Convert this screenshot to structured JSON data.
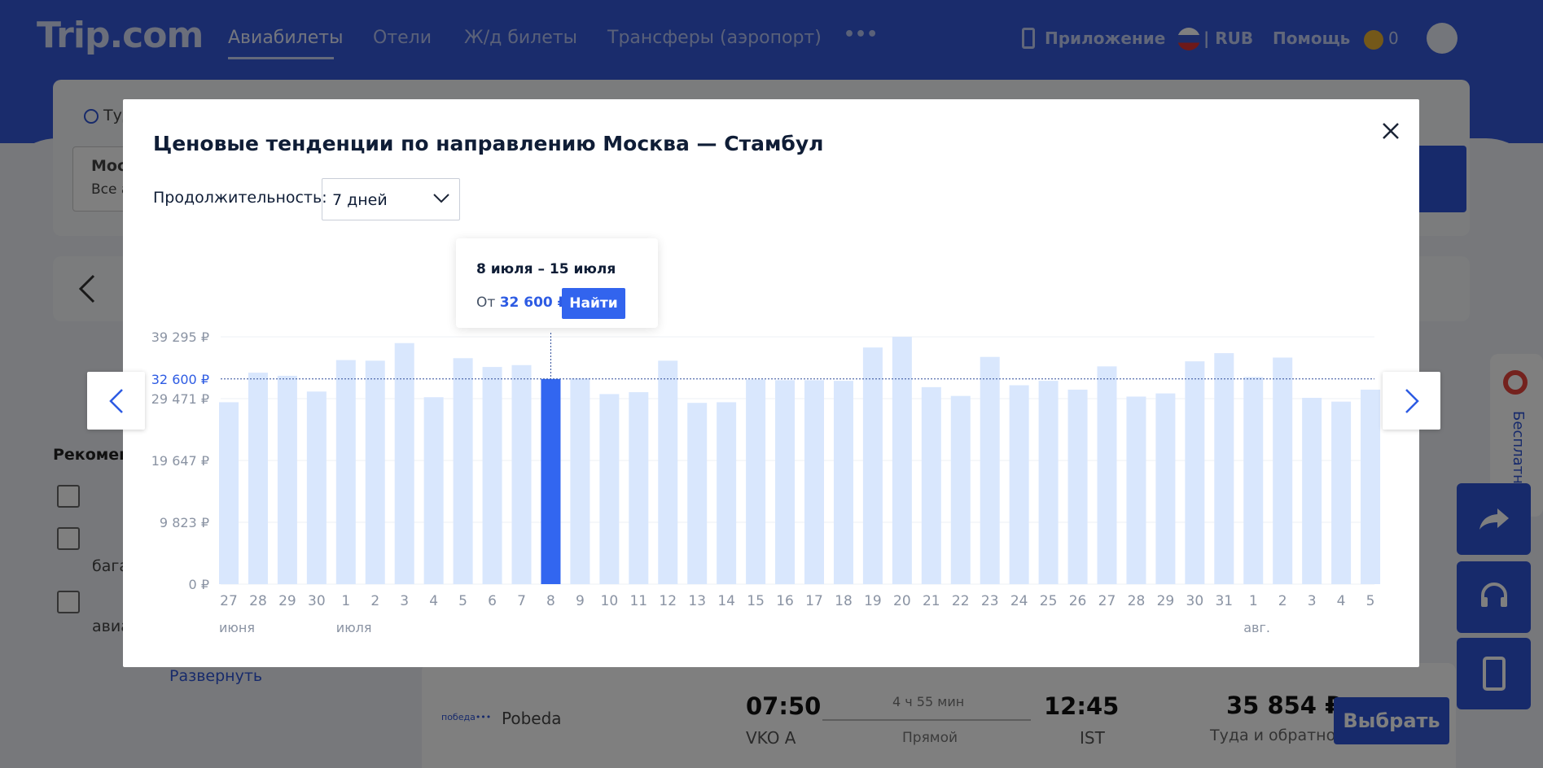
{
  "header": {
    "logo": "Trip.com",
    "nav": [
      "Авиабилеты",
      "Отели",
      "Ж/д билеты",
      "Трансферы (аэропорт)"
    ],
    "more": "•••",
    "app_label": "Приложение",
    "currency": "| RUB",
    "help": "Помощь",
    "points": "0"
  },
  "background": {
    "trip_type": "Туда",
    "from_city": "Мос",
    "from_sub": "Все а",
    "recommended": "Рекоменд",
    "filter_bagg": "бага",
    "filter_avia": "авиа",
    "expand": "Развернуть",
    "chrome_label": "Бесплатн",
    "flight": {
      "airline": "Pobeda",
      "depart_time": "07:50",
      "depart_airport": "VKO A",
      "duration": "4 ч 55 мин",
      "stops": "Прямой",
      "arrive_time": "12:45",
      "arrive_airport": "IST",
      "price": "35 854 ₽",
      "price_note": "Туда и обратно",
      "select": "Выбрать"
    }
  },
  "modal": {
    "title": "Ценовые тенденции по направлению Москва — Стамбул",
    "duration_label": "Продолжительность:",
    "duration_value": "7 дней",
    "tooltip": {
      "dates": "8 июля – 15 июля",
      "from_prefix": "От",
      "price": "32 600 ₽",
      "button": "Найти"
    }
  },
  "chart_data": {
    "type": "bar",
    "title": "",
    "xlabel": "",
    "ylabel": "",
    "ylim": [
      0,
      39295
    ],
    "ytick_labels": [
      "0 ₽",
      "9 823 ₽",
      "19 647 ₽",
      "29 471 ₽",
      "32 600 ₽",
      "39 295 ₽"
    ],
    "ytick_values": [
      0,
      9823,
      19647,
      29471,
      32600,
      39295
    ],
    "reference_line": {
      "value": 32600,
      "label": "32 600 ₽"
    },
    "categories": [
      "27",
      "28",
      "29",
      "30",
      "1",
      "2",
      "3",
      "4",
      "5",
      "6",
      "7",
      "8",
      "9",
      "10",
      "11",
      "12",
      "13",
      "14",
      "15",
      "16",
      "17",
      "18",
      "19",
      "20",
      "21",
      "22",
      "23",
      "24",
      "25",
      "26",
      "27",
      "28",
      "29",
      "30",
      "31",
      "1",
      "2",
      "3",
      "4",
      "5",
      "6"
    ],
    "month_labels": [
      {
        "index": 0,
        "label": "июня"
      },
      {
        "index": 4,
        "label": "июля"
      },
      {
        "index": 35,
        "label": "авг."
      }
    ],
    "values": [
      28900,
      33600,
      33100,
      30600,
      35600,
      35500,
      38300,
      29700,
      35900,
      34500,
      34800,
      32600,
      32700,
      30200,
      30500,
      35500,
      28800,
      28900,
      32500,
      32400,
      32400,
      32300,
      37600,
      39295,
      31300,
      29900,
      36100,
      31600,
      32300,
      30900,
      34600,
      29800,
      30300,
      35400,
      36700,
      32900,
      36000,
      29600,
      29000,
      30900,
      31200
    ],
    "selected_index": 11,
    "colors": {
      "bar": "#d9e7fd",
      "selected": "#3266f0",
      "axis_text": "#8a93a3"
    }
  }
}
